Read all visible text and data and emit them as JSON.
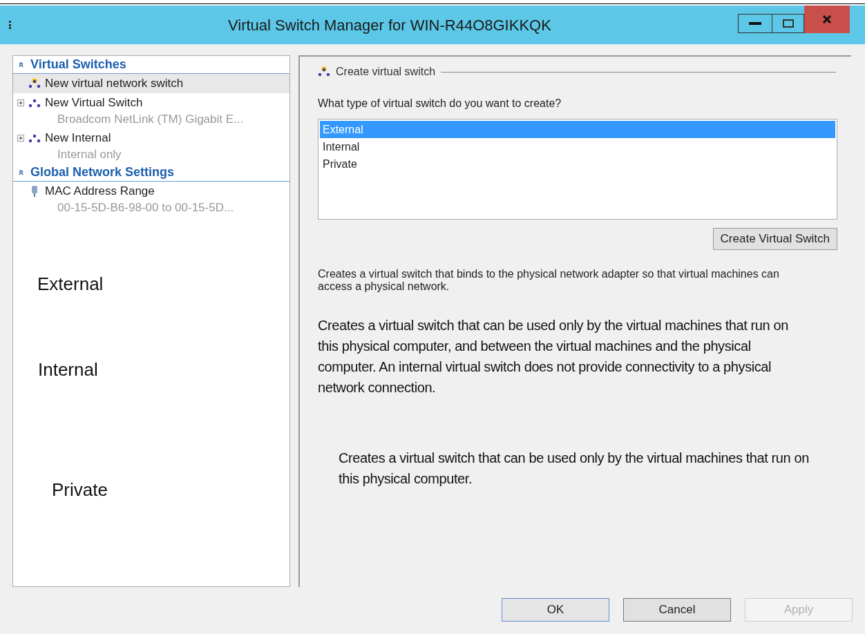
{
  "window": {
    "title": "Virtual Switch Manager for WIN-R44O8GIKKQK"
  },
  "tree": [
    {
      "kind": "section",
      "label": "Virtual Switches",
      "expanded": true,
      "children": [
        {
          "kind": "new",
          "label": "New virtual network switch",
          "selected": true
        },
        {
          "kind": "switch",
          "label": "New Virtual Switch",
          "detail": "Broadcom NetLink (TM) Gigabit E...",
          "selected": false,
          "expanded": false
        },
        {
          "kind": "switch",
          "label": "New Internal",
          "detail": "Internal only",
          "selected": false,
          "expanded": false
        }
      ]
    },
    {
      "kind": "section",
      "label": "Global Network Settings",
      "expanded": true,
      "children": [
        {
          "kind": "mac",
          "label": "MAC Address Range",
          "detail": "00-15-5D-B6-98-00 to 00-15-5D...",
          "selected": false
        }
      ]
    }
  ],
  "annotations": [
    "External",
    "Internal",
    "Private"
  ],
  "create": {
    "heading": "Create virtual switch",
    "question": "What type of virtual switch do you want to create?",
    "types": [
      {
        "label": "External",
        "selected": true
      },
      {
        "label": "Internal",
        "selected": false
      },
      {
        "label": "Private",
        "selected": false
      }
    ],
    "button": "Create Virtual Switch",
    "description": "Creates a virtual switch that binds to the physical network adapter so that virtual machines can access a physical network."
  },
  "notes": [
    "Creates a virtual switch that can be used only by the virtual machines that run on this physical computer, and between the virtual machines and the physical computer. An internal virtual switch does not provide connectivity to a physical network connection.",
    "Creates a virtual switch that can be used only by the virtual machines that run on this physical computer."
  ],
  "buttons": [
    {
      "label": "OK",
      "disabled": false,
      "default": true
    },
    {
      "label": "Cancel",
      "disabled": false,
      "default": false
    },
    {
      "label": "Apply",
      "disabled": true,
      "default": false
    }
  ]
}
